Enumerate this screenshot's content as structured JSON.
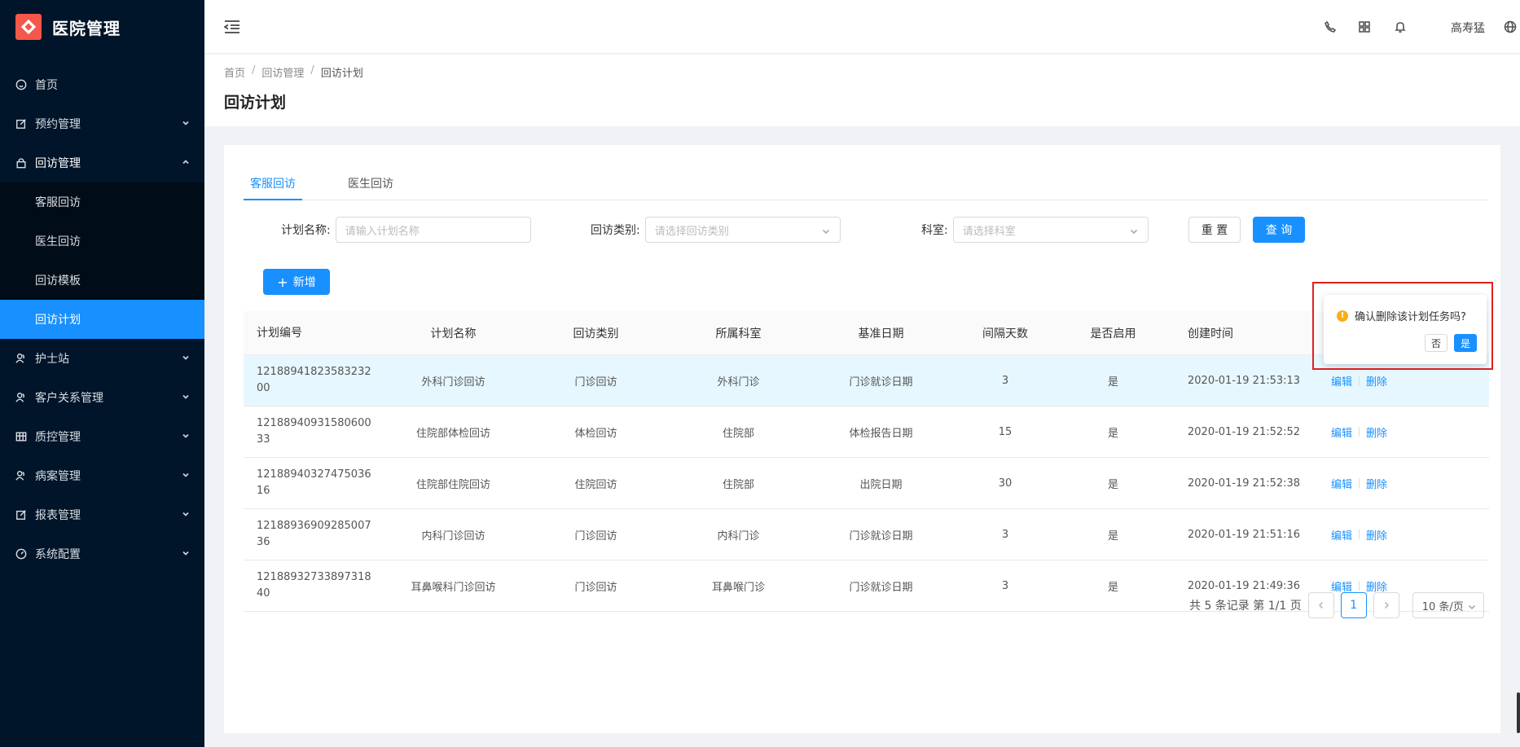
{
  "app": {
    "title": "医院管理"
  },
  "sidebar": {
    "items": [
      {
        "label": "首页",
        "icon": "smile-icon"
      },
      {
        "label": "预约管理",
        "icon": "edit-icon"
      },
      {
        "label": "回访管理",
        "icon": "lock-icon"
      },
      {
        "label": "护士站",
        "icon": "users-icon"
      },
      {
        "label": "客户关系管理",
        "icon": "users-icon"
      },
      {
        "label": "质控管理",
        "icon": "table-icon"
      },
      {
        "label": "病案管理",
        "icon": "users-icon"
      },
      {
        "label": "报表管理",
        "icon": "edit-icon"
      },
      {
        "label": "系统配置",
        "icon": "dashboard-icon"
      }
    ],
    "sub_items": [
      "客服回访",
      "医生回访",
      "回访模板",
      "回访计划"
    ]
  },
  "header": {
    "user": "高寿猛"
  },
  "breadcrumb": [
    "首页",
    "回访管理",
    "回访计划"
  ],
  "page_title": "回访计划",
  "tabs": [
    "客服回访",
    "医生回访"
  ],
  "filters": {
    "plan_name_label": "计划名称:",
    "plan_name_placeholder": "请输入计划名称",
    "type_label": "回访类别:",
    "type_placeholder": "请选择回访类别",
    "dept_label": "科室:",
    "dept_placeholder": "请选择科室",
    "reset": "重 置",
    "query": "查 询"
  },
  "add_button": "新增",
  "table": {
    "columns": [
      "计划编号",
      "计划名称",
      "回访类别",
      "所属科室",
      "基准日期",
      "间隔天数",
      "是否启用",
      "创建时间"
    ],
    "rows": [
      {
        "id": "1218894182358323200",
        "name": "外科门诊回访",
        "type": "门诊回访",
        "dept": "外科门诊",
        "base": "门诊就诊日期",
        "days": "3",
        "enabled": "是",
        "created": "2020-01-19 21:53:13"
      },
      {
        "id": "1218894093158060033",
        "name": "住院部体检回访",
        "type": "体检回访",
        "dept": "住院部",
        "base": "体检报告日期",
        "days": "15",
        "enabled": "是",
        "created": "2020-01-19 21:52:52"
      },
      {
        "id": "1218894032747503616",
        "name": "住院部住院回访",
        "type": "住院回访",
        "dept": "住院部",
        "base": "出院日期",
        "days": "30",
        "enabled": "是",
        "created": "2020-01-19 21:52:38"
      },
      {
        "id": "1218893690928500736",
        "name": "内科门诊回访",
        "type": "门诊回访",
        "dept": "内科门诊",
        "base": "门诊就诊日期",
        "days": "3",
        "enabled": "是",
        "created": "2020-01-19 21:51:16"
      },
      {
        "id": "1218893273389731840",
        "name": "耳鼻喉科门诊回访",
        "type": "门诊回访",
        "dept": "耳鼻喉门诊",
        "base": "门诊就诊日期",
        "days": "3",
        "enabled": "是",
        "created": "2020-01-19 21:49:36"
      }
    ],
    "edit": "编辑",
    "delete": "删除"
  },
  "pagination": {
    "summary": "共 5 条记录 第 1/1 页",
    "current": "1",
    "page_size": "10 条/页"
  },
  "popconfirm": {
    "message": "确认删除该计划任务吗?",
    "no": "否",
    "yes": "是"
  },
  "colors": {
    "primary": "#1890ff",
    "sidebar": "#001529",
    "danger_outline": "#e02020",
    "warning": "#faad14"
  }
}
